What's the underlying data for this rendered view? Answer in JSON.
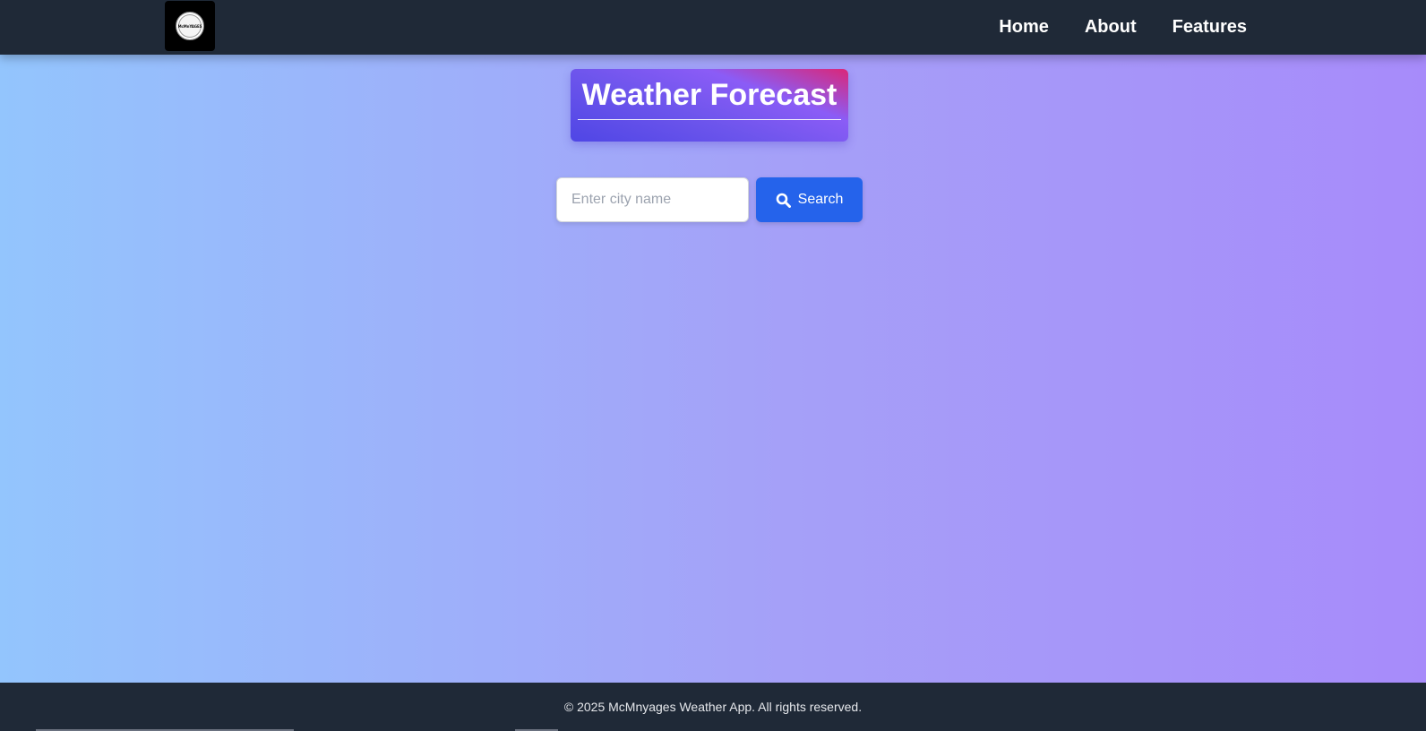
{
  "header": {
    "logo_text": "McMnYAGES",
    "nav": [
      "Home",
      "About",
      "Features"
    ]
  },
  "main": {
    "title": "Weather Forecast",
    "search": {
      "placeholder": "Enter city name",
      "value": "",
      "button_label": "Search",
      "button_icon": "search-icon"
    }
  },
  "footer": {
    "text": "© 2025 McMnyages Weather App. All rights reserved."
  },
  "colors": {
    "header_bg": "#1f2937",
    "button_bg": "#2563eb",
    "background_start": "#93c5fd",
    "background_end": "#a78bfa"
  }
}
